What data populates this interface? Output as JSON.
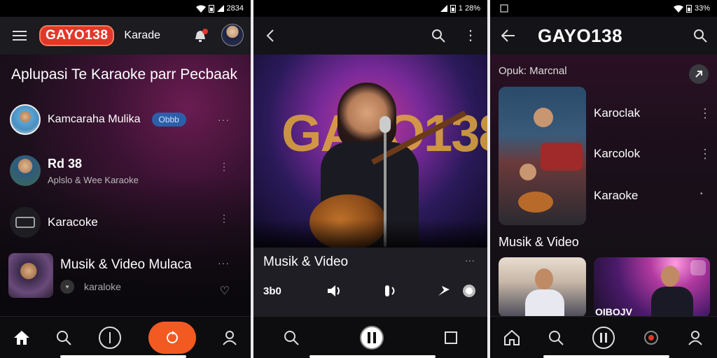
{
  "status": {
    "p1_time": "2834",
    "p2_time": "1 28%",
    "p3_time": "33%"
  },
  "phone1": {
    "brand": "GAYO138",
    "tab_label": "Karade",
    "heading": "Aplupasi Te Karaoke parr Pecbaak",
    "items": [
      {
        "title": "Kamcaraha Mulika",
        "badge": "Obbb"
      },
      {
        "title": "Rd 38",
        "subtitle": "Aplslo & Wee Karaoke"
      },
      {
        "title": "Karacoke"
      },
      {
        "title": "Musik & Video Mulaca",
        "subtitle": "karaloke"
      }
    ]
  },
  "phone2": {
    "hero_text": "GAYO138",
    "section_title": "Musik & Video",
    "control_label": "3b0"
  },
  "phone3": {
    "brand": "GAYO138",
    "section1_title": "Opuk: Marcnal",
    "items": [
      "Karoclak",
      "Karcolok",
      "Karaoke"
    ],
    "section2_title": "Musik & Video",
    "thumb_caption": "OIBOJV"
  },
  "colors": {
    "accent": "#f25a22",
    "brand_red": "#e0382a",
    "badge_blue": "#2c5fa8",
    "background": "#141418"
  },
  "icons": [
    "menu-icon",
    "bell-icon",
    "avatar",
    "back-icon",
    "search-icon",
    "more-vert-icon",
    "home-icon",
    "play-pause-icon",
    "refresh-icon",
    "profile-icon",
    "stop-icon",
    "share-icon",
    "heart-icon"
  ]
}
